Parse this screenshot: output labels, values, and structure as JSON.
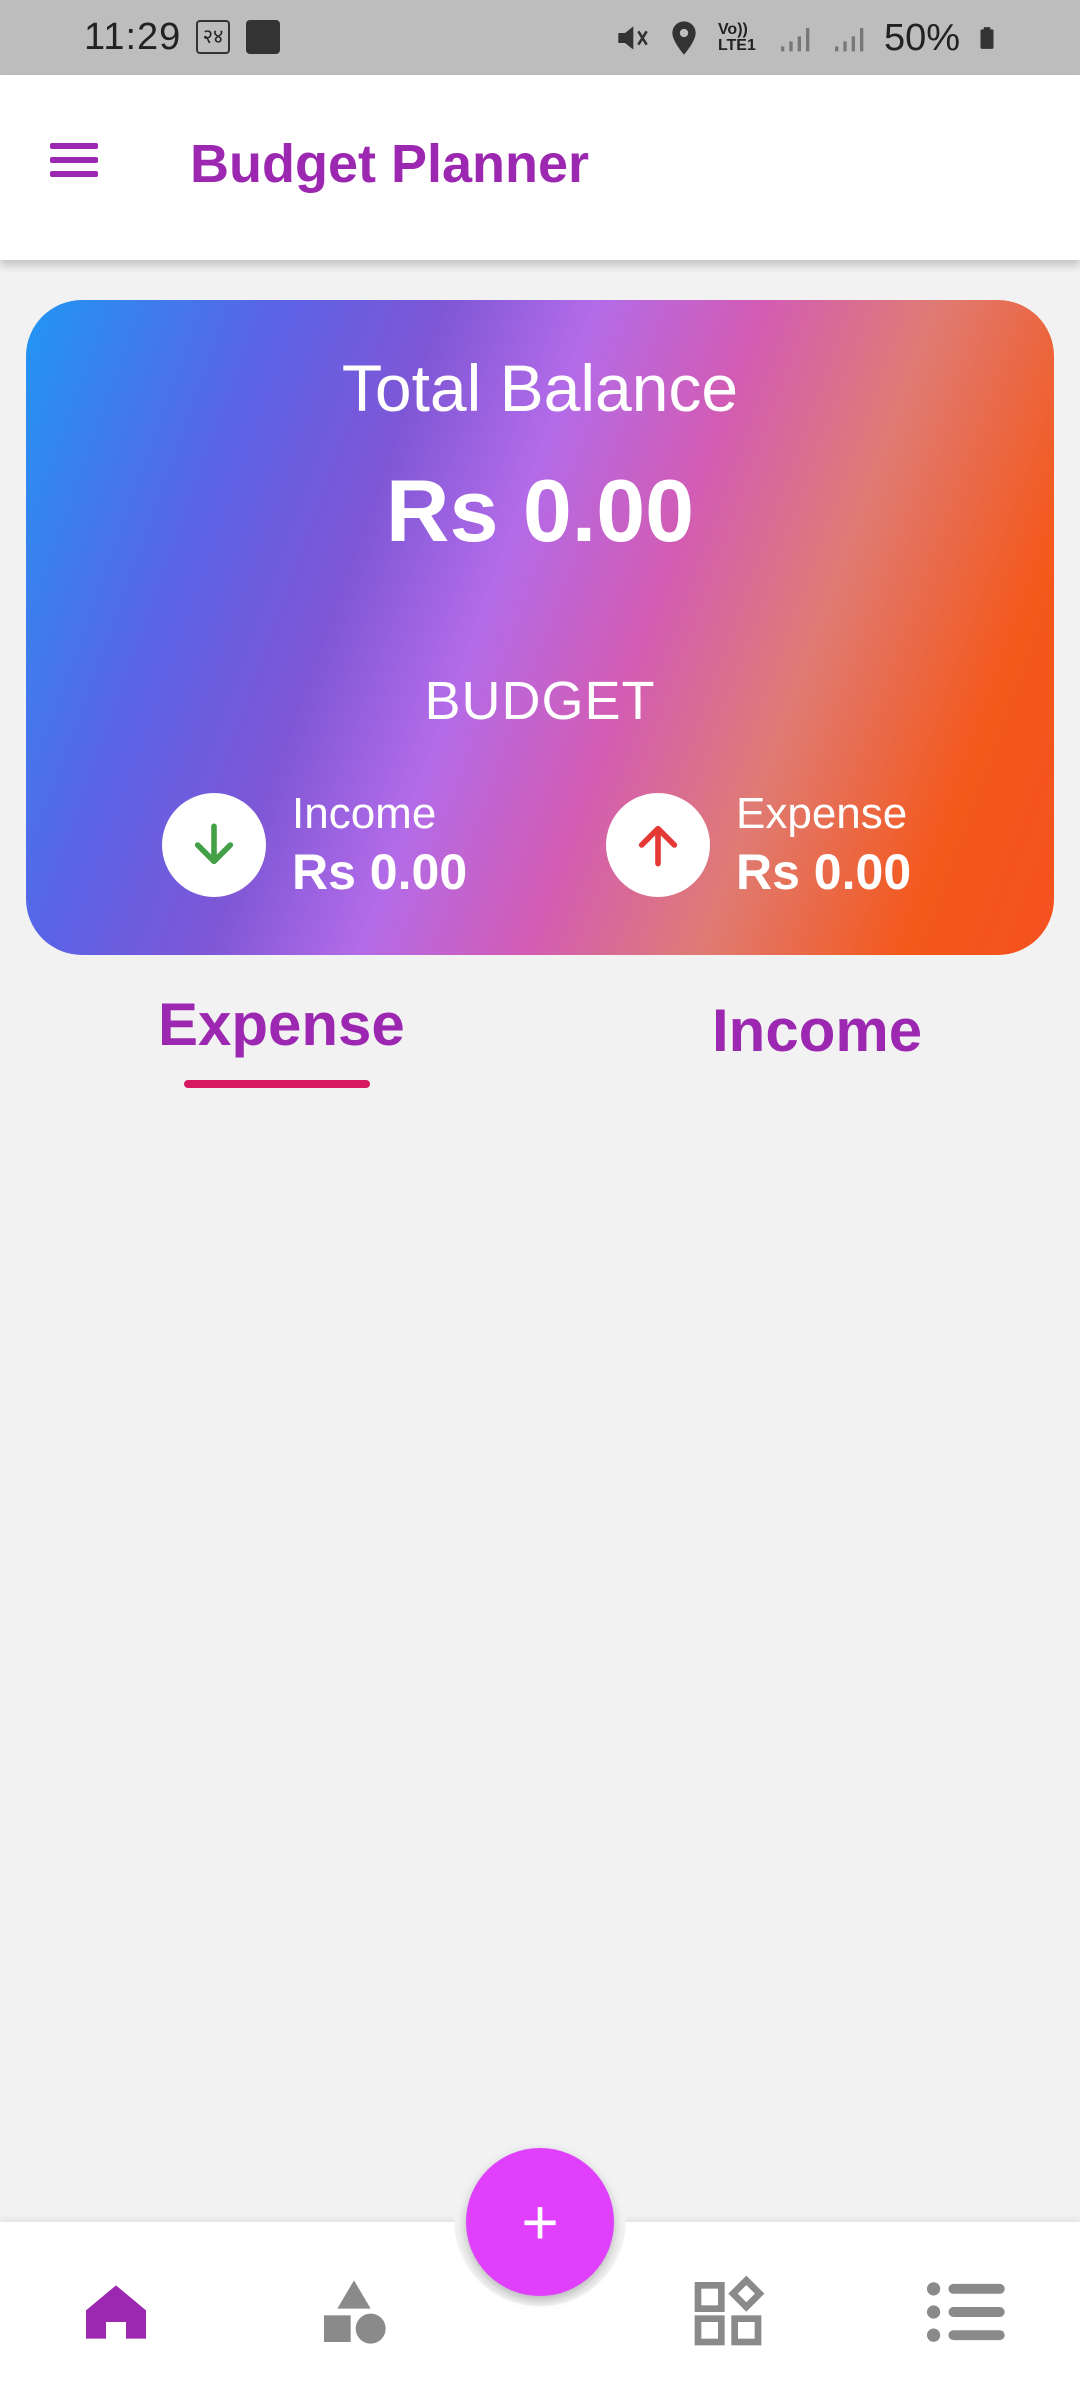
{
  "status_bar": {
    "time": "11:29",
    "carrier_badge": "२४",
    "network_label": "Vo)) LTE1",
    "battery_percent": "50%"
  },
  "appbar": {
    "title": "Budget Planner"
  },
  "balance_card": {
    "title": "Total Balance",
    "amount": "Rs 0.00",
    "section_label": "BUDGET",
    "income": {
      "label": "Income",
      "value": "Rs 0.00"
    },
    "expense": {
      "label": "Expense",
      "value": "Rs 0.00"
    }
  },
  "tabs": [
    {
      "label": "Expense",
      "selected": true
    },
    {
      "label": "Income",
      "selected": false
    }
  ],
  "fab": {
    "label": "+"
  },
  "bottom_nav": [
    {
      "icon": "home-icon",
      "active": true
    },
    {
      "icon": "categories-icon",
      "active": false
    },
    {
      "icon": "widgets-icon",
      "active": false
    },
    {
      "icon": "list-icon",
      "active": false
    }
  ],
  "colors": {
    "primary": "#9c27b0",
    "tab_indicator": "#d81b60",
    "fab": "#e040fb",
    "income_arrow": "#43a047",
    "expense_arrow": "#e53935",
    "inactive_icon": "#8a8a8a"
  }
}
